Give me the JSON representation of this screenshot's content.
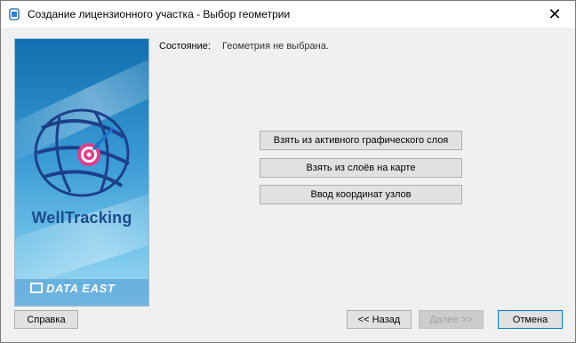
{
  "window": {
    "title": "Создание лицензионного участка - Выбор геометрии",
    "close_glyph": "✕"
  },
  "banner": {
    "brand": "WellTracking",
    "vendor": "DATA EAST"
  },
  "status": {
    "label": "Состояние:",
    "value": "Геометрия не выбрана."
  },
  "actions": {
    "from_active_layer": "Взять из активного графического слоя",
    "from_map_layers": "Взять из слоёв на карте",
    "enter_coordinates": "Ввод координат узлов"
  },
  "footer": {
    "help": "Справка",
    "back": "<< Назад",
    "next": "Далее >>",
    "cancel": "Отмена"
  },
  "colors": {
    "accent": "#0078d7",
    "banner_top": "#0f6fb0",
    "brand_text": "#1b4c8c"
  },
  "icons": {
    "app": "dialog-app-icon",
    "close": "close-icon",
    "globe": "globe-logo-icon",
    "target": "target-icon",
    "vendor": "data-east-logo-icon"
  }
}
